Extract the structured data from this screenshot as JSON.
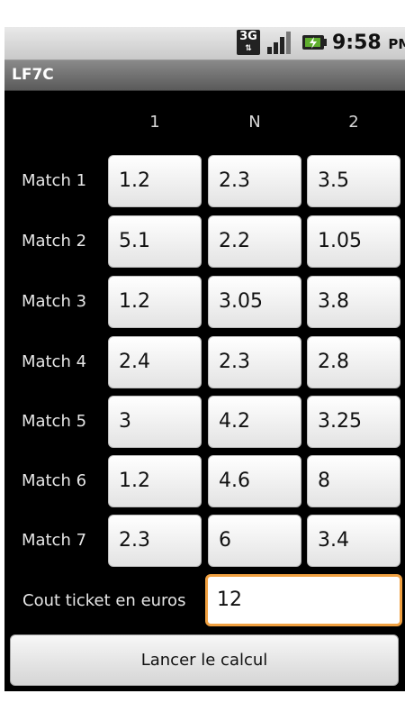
{
  "status_bar": {
    "network": "3G",
    "time": "9:58",
    "ampm": "PM",
    "icons": [
      "network-3g-icon",
      "signal-icon",
      "battery-icon"
    ]
  },
  "app": {
    "title": "LF7C"
  },
  "columns": [
    "1",
    "N",
    "2"
  ],
  "matches": [
    {
      "label": "Match 1",
      "odds": [
        "1.2",
        "2.3",
        "3.5"
      ]
    },
    {
      "label": "Match 2",
      "odds": [
        "5.1",
        "2.2",
        "1.05"
      ]
    },
    {
      "label": "Match 3",
      "odds": [
        "1.2",
        "3.05",
        "3.8"
      ]
    },
    {
      "label": "Match 4",
      "odds": [
        "2.4",
        "2.3",
        "2.8"
      ]
    },
    {
      "label": "Match 5",
      "odds": [
        "3",
        "4.2",
        "3.25"
      ]
    },
    {
      "label": "Match 6",
      "odds": [
        "1.2",
        "4.6",
        "8"
      ]
    },
    {
      "label": "Match 7",
      "odds": [
        "2.3",
        "6",
        "3.4"
      ]
    }
  ],
  "cost": {
    "label": "Cout ticket en euros",
    "value": "12"
  },
  "button": {
    "label": "Lancer le calcul"
  },
  "colors": {
    "focus": "#f0a040",
    "background": "#000000"
  }
}
